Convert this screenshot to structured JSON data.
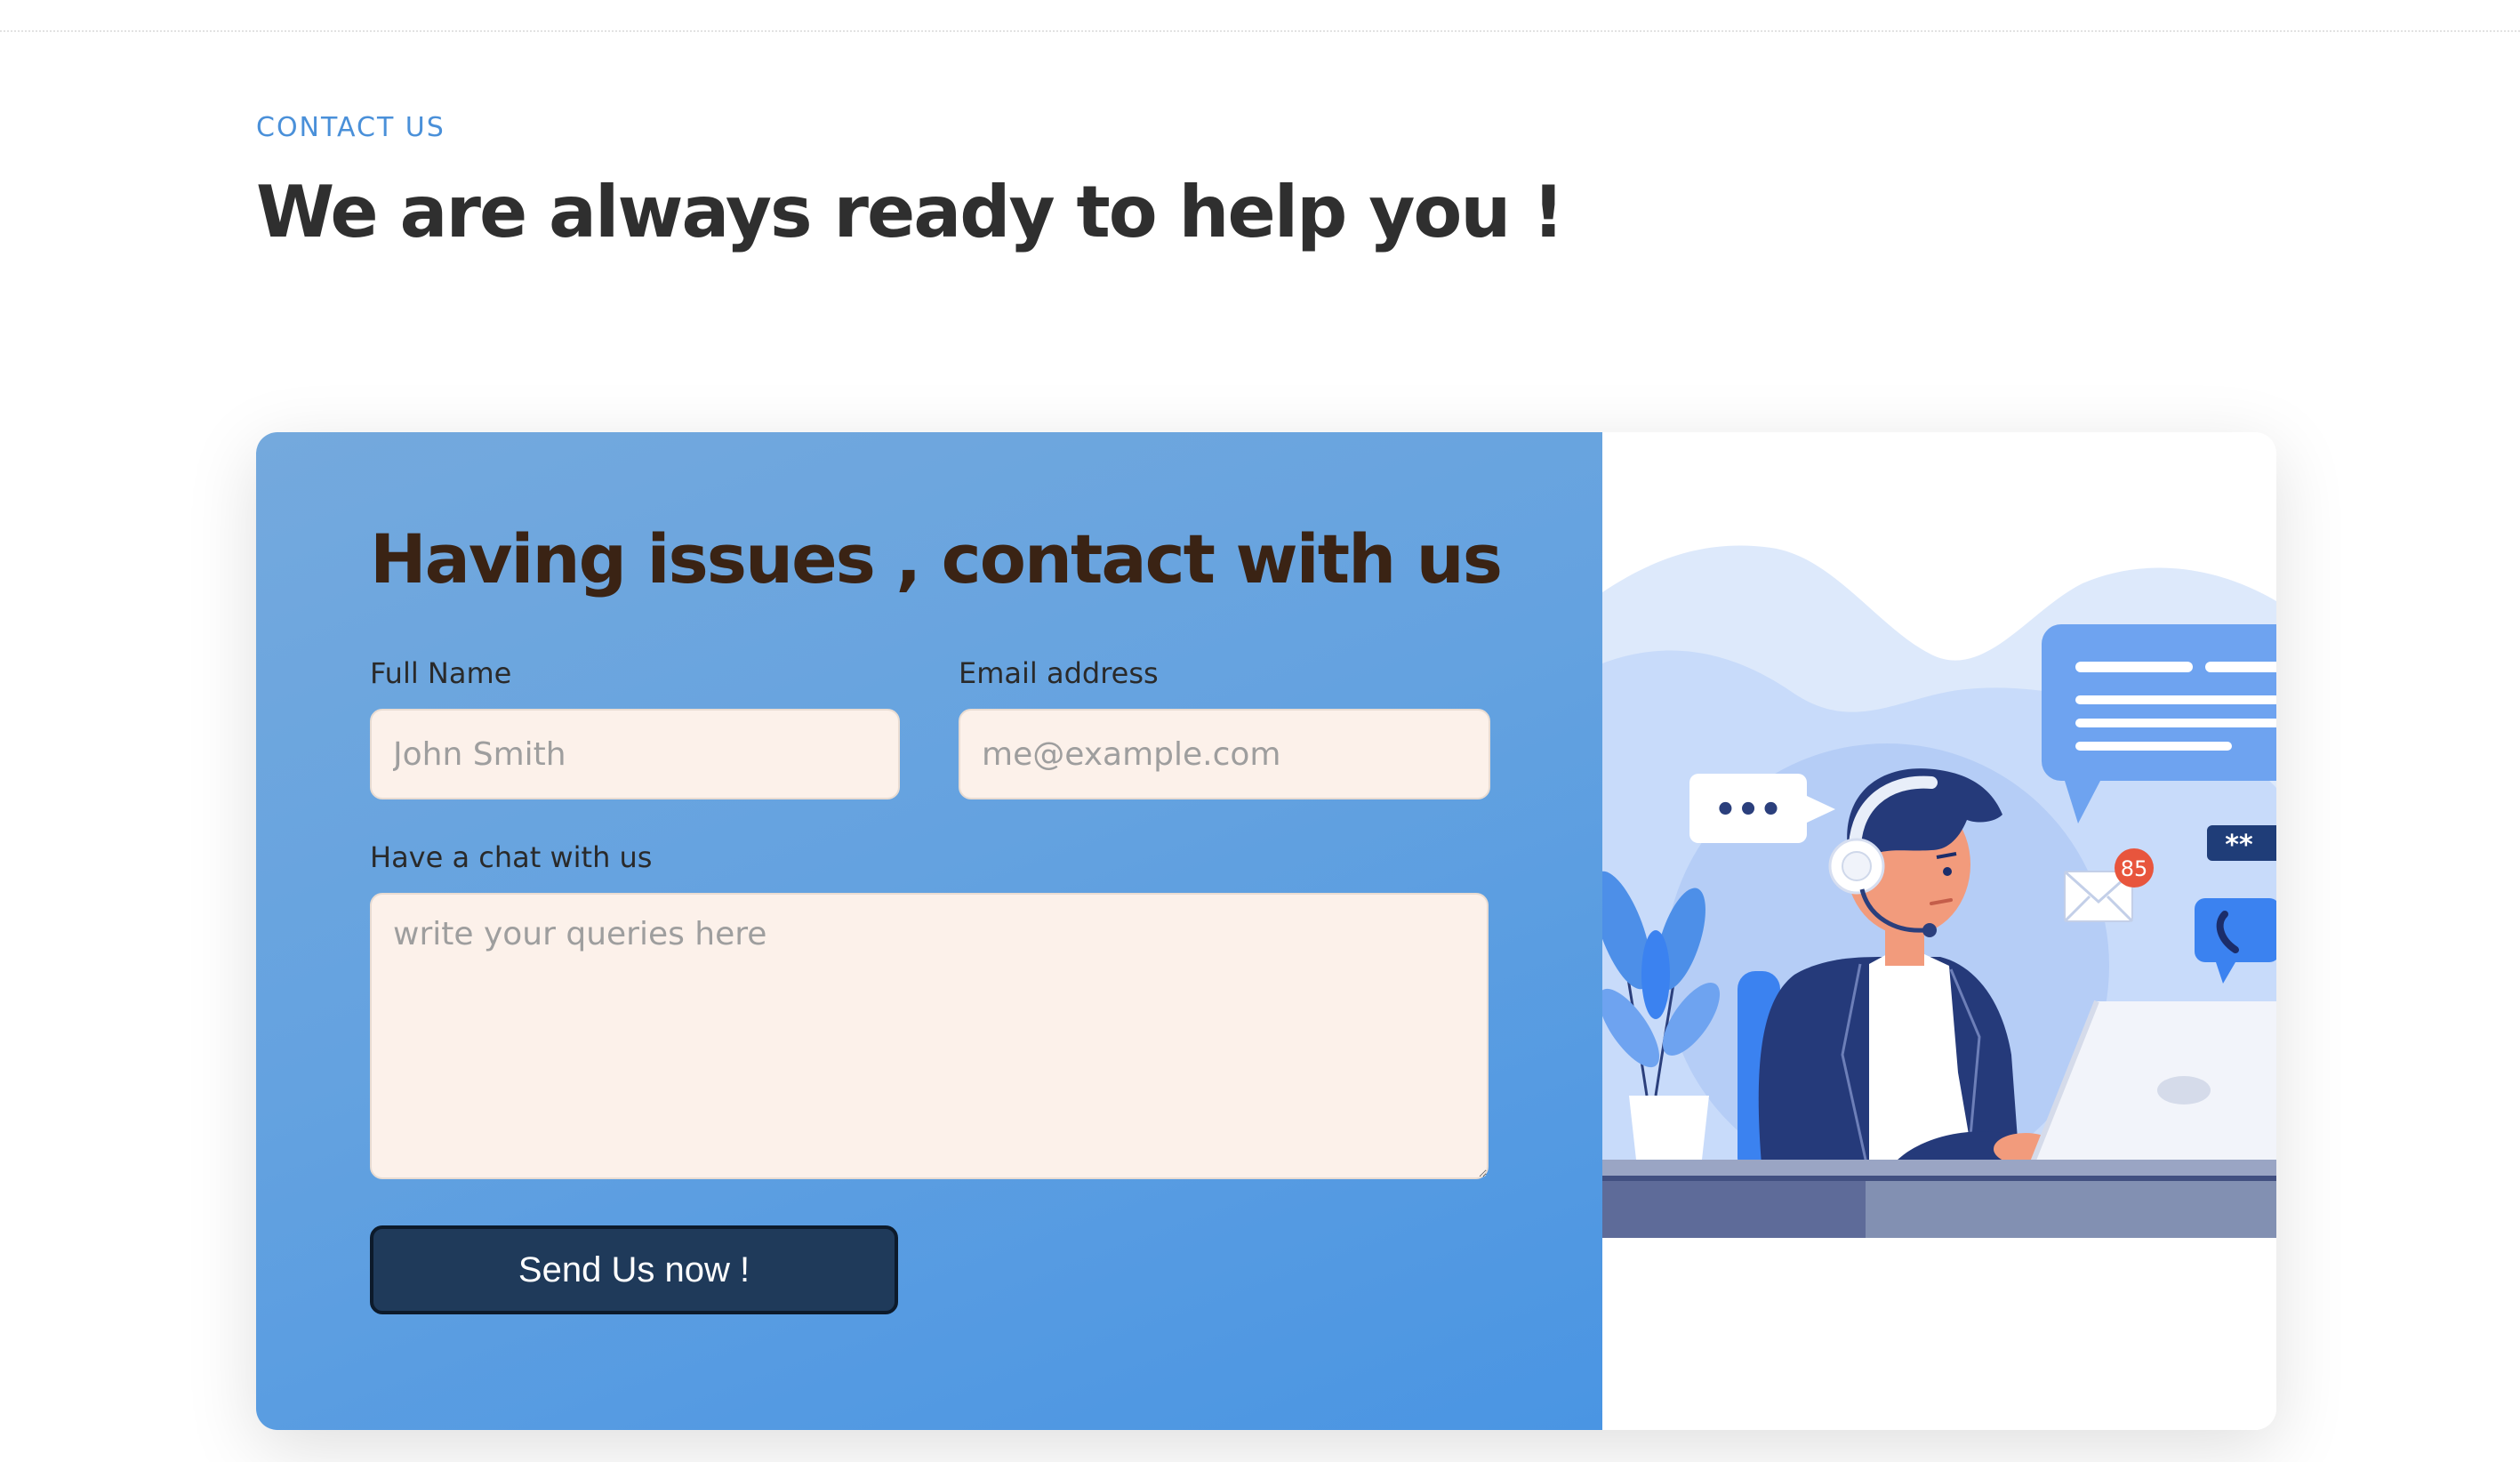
{
  "section": {
    "eyebrow": "CONTACT US",
    "title": "We are always ready to help you !"
  },
  "form": {
    "title": "Having issues , contact with us",
    "full_name": {
      "label": "Full Name",
      "placeholder": "John Smith"
    },
    "email": {
      "label": "Email address",
      "placeholder": "me@example.com"
    },
    "message": {
      "label": "Have a chat with us",
      "placeholder": "write your queries here"
    },
    "submit_label": "Send Us now !"
  },
  "illustration": {
    "mail_badge_count": "85",
    "password_badge": "**",
    "chat_bubble_text": "•••"
  },
  "colors": {
    "accent": "#4a90d9",
    "form_panel": "#64a2e0",
    "input_background": "#fcf1ea",
    "button_background": "#1f3a5a",
    "form_title": "#3a2314",
    "section_title": "#2f2f2f"
  }
}
